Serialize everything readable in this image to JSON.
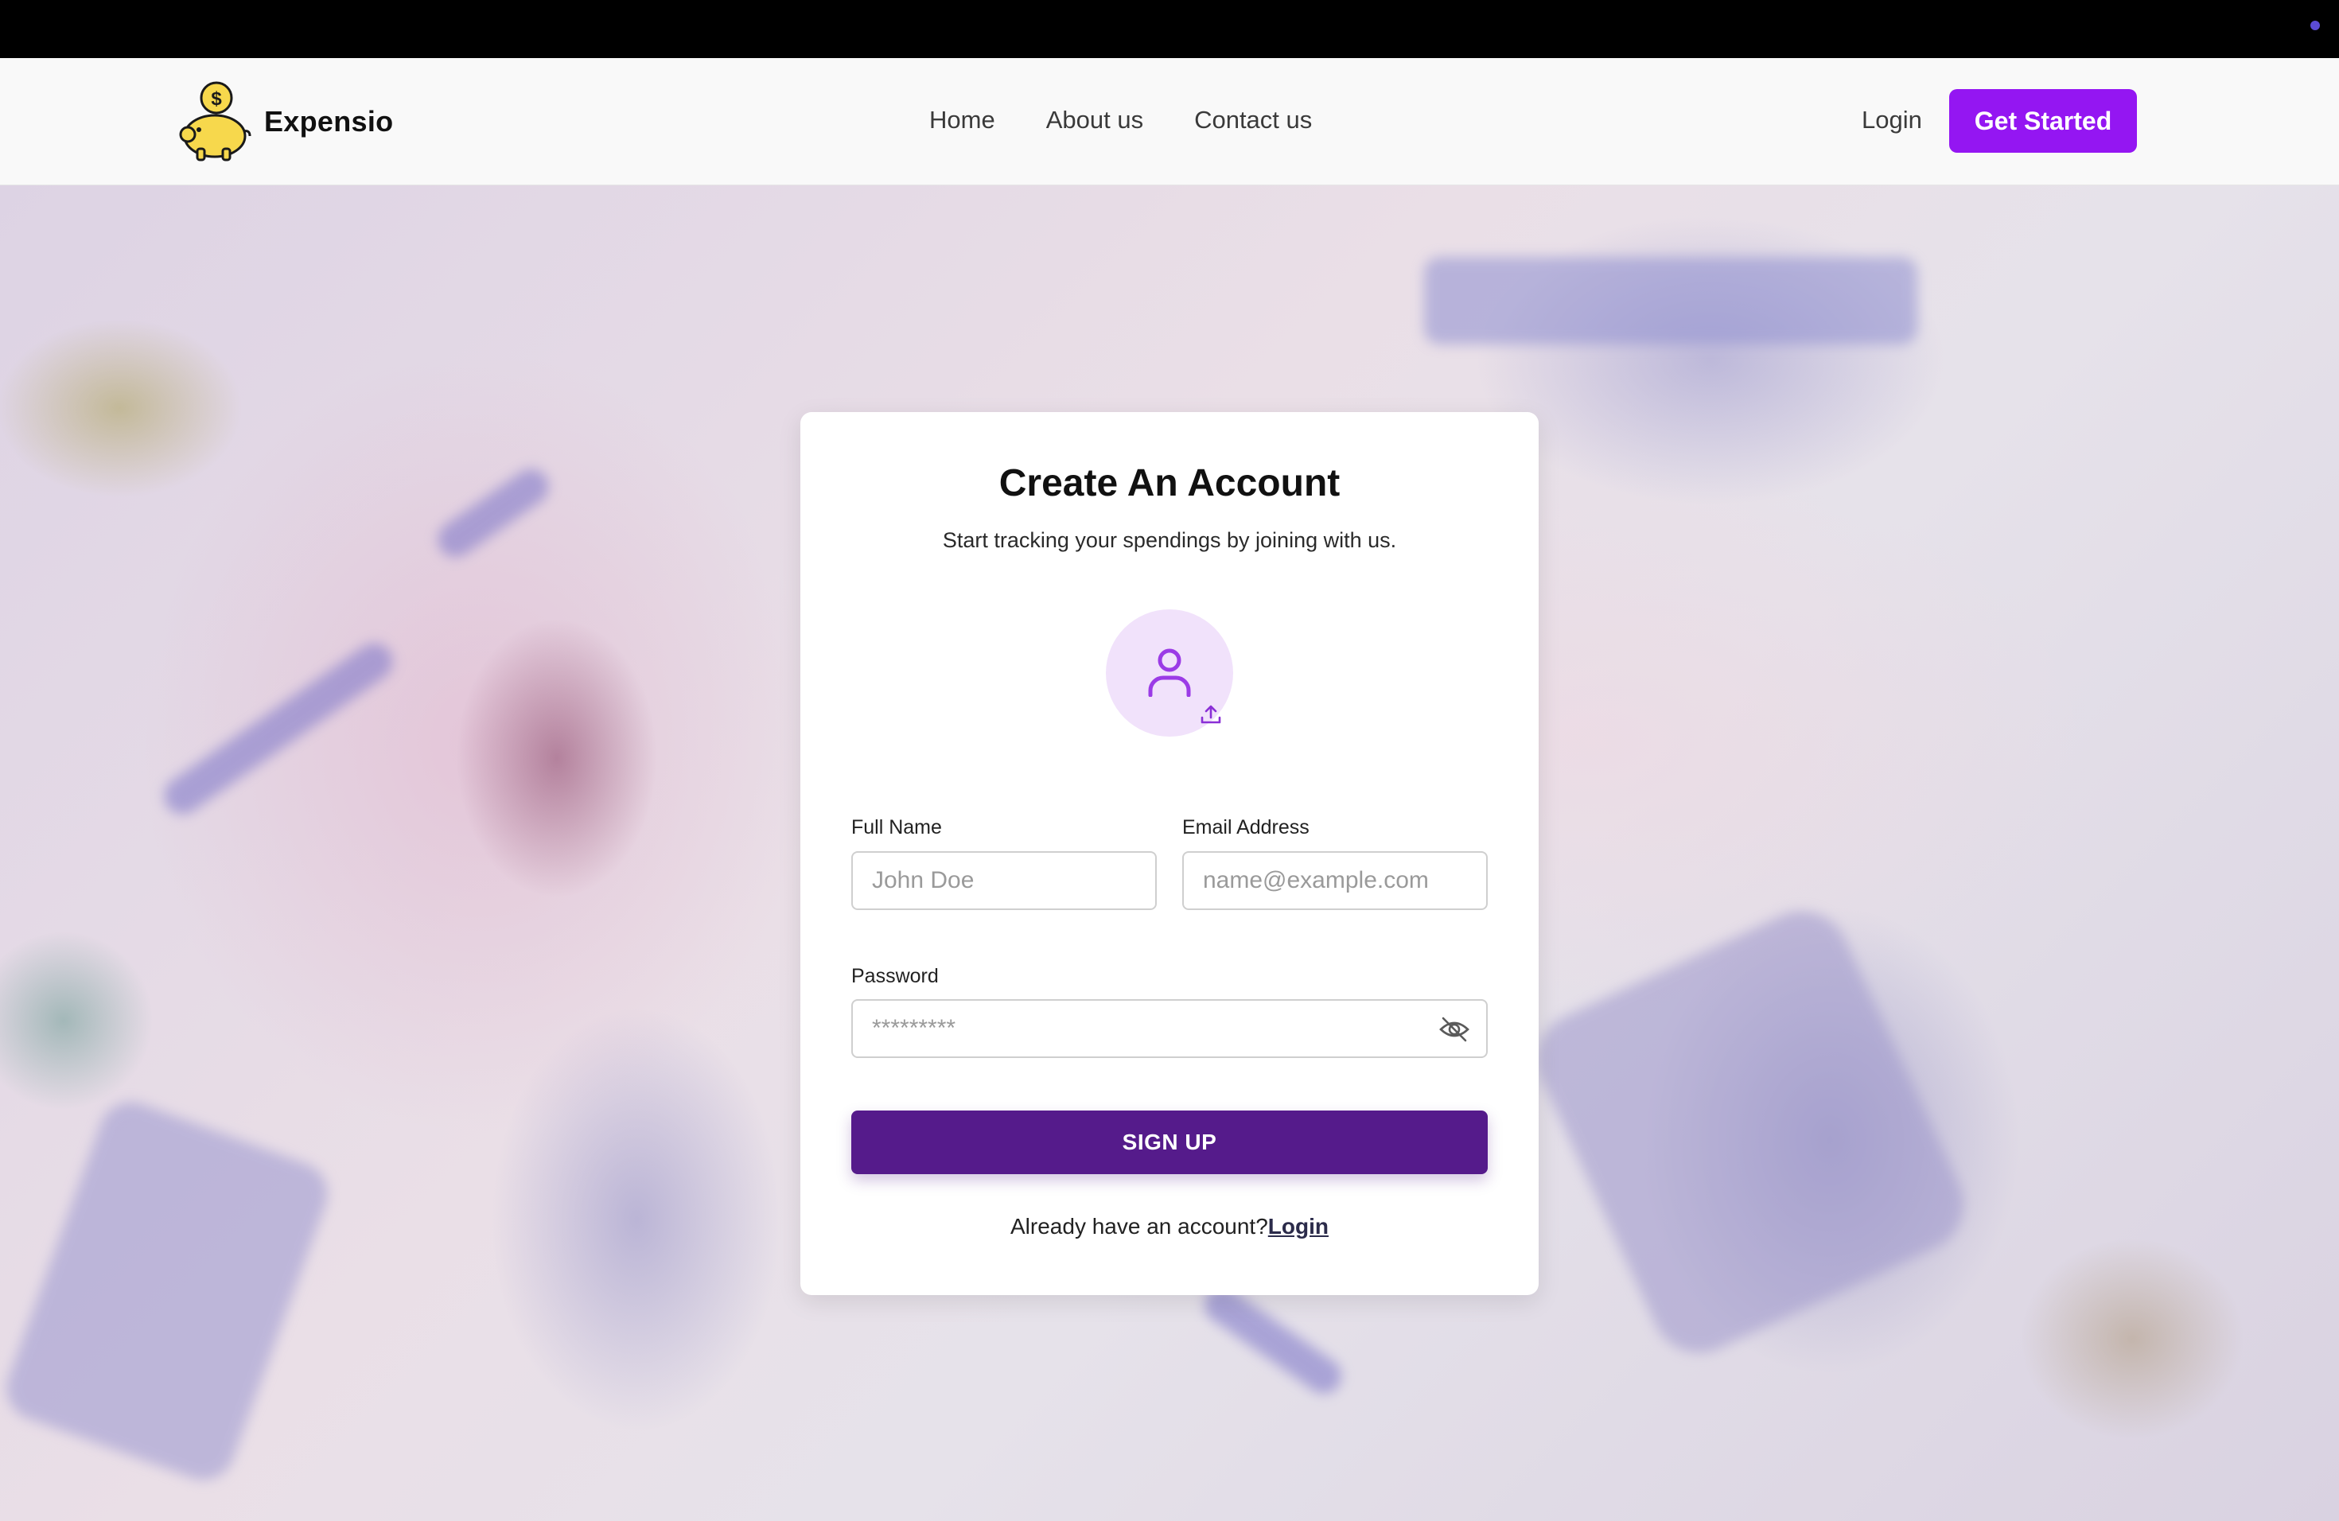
{
  "brand": {
    "name": "Expensio",
    "accent_color": "#9416f2"
  },
  "nav": {
    "links": [
      "Home",
      "About us",
      "Contact us"
    ],
    "login_label": "Login",
    "cta_label": "Get Started"
  },
  "form": {
    "title": "Create An Account",
    "subtitle": "Start tracking your spendings by joining with us.",
    "avatar_icon": "user-icon",
    "upload_icon": "upload-icon",
    "full_name": {
      "label": "Full Name",
      "placeholder": "John Doe",
      "value": ""
    },
    "email": {
      "label": "Email Address",
      "placeholder": "name@example.com",
      "value": ""
    },
    "password": {
      "label": "Password",
      "placeholder": "*********",
      "value": "",
      "toggle_icon": "eye-off-icon"
    },
    "submit_label": "SIGN UP",
    "submit_color": "#551b8b",
    "already_text": "Already have an account?",
    "login_link": "Login"
  }
}
